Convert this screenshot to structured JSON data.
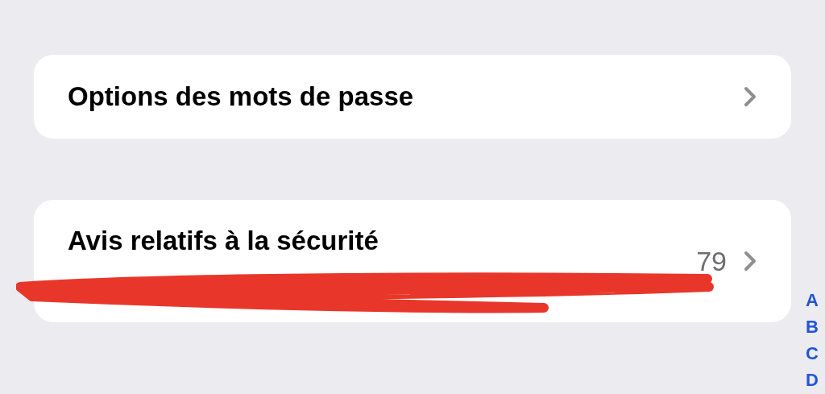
{
  "rows": [
    {
      "title": "Options des mots de passe"
    },
    {
      "title": "Avis relatifs à la sécurité",
      "count": "79"
    }
  ],
  "index": [
    "A",
    "B",
    "C",
    "D"
  ]
}
